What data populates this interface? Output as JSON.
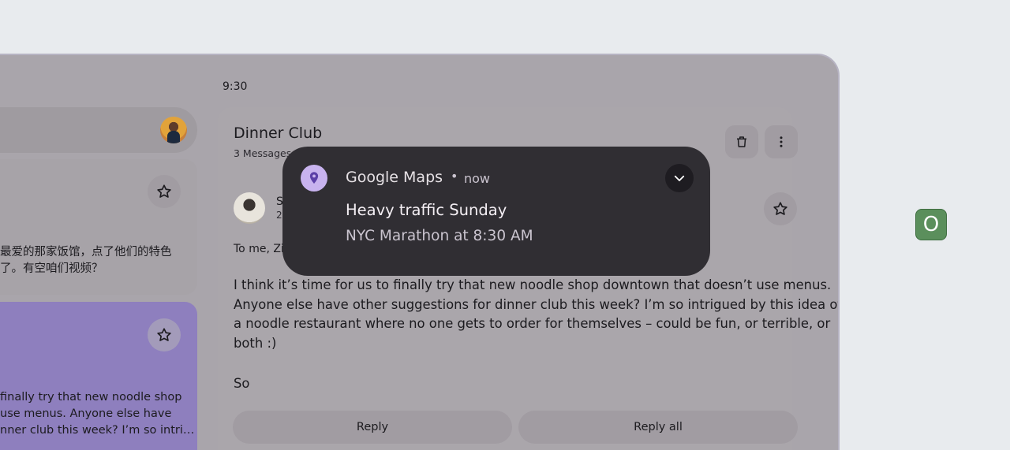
{
  "status_bar": {
    "time": "9:30"
  },
  "list_pane": {
    "card1": {
      "preview_lines": [
        "最爱的那家饭馆，点了他们的特色",
        "了。有空咱们视频？"
      ]
    },
    "card2": {
      "preview_lines": [
        "finally try that new noodle shop",
        "use menus. Anyone else have",
        "nner club this week? I’m so intri…"
      ]
    }
  },
  "thread": {
    "title": "Dinner Club",
    "count": "3 Messages",
    "sender_initial": "S",
    "sender_date_partial": "20",
    "to_line": "To me, Zia",
    "body_lines": [
      "I think it’s time for us to finally try that new noodle shop downtown that doesn’t use menus.",
      "Anyone else have other suggestions for dinner club this week? I’m so intrigued by this idea of",
      "a noodle restaurant where no one gets to order for themselves – could be fun, or terrible, or",
      "both :)"
    ],
    "signature": "So",
    "reply_label": "Reply",
    "reply_all_label": "Reply all"
  },
  "notification": {
    "app_name": "Google Maps",
    "separator": "•",
    "time": "now",
    "title": "Heavy traffic Sunday",
    "text": "NYC Marathon at 8:30 AM",
    "app_icon": "location-pin-icon",
    "accent_color": "#c8b3ef"
  },
  "overview_button": {
    "label": "O",
    "color": "#5b8f5c"
  }
}
